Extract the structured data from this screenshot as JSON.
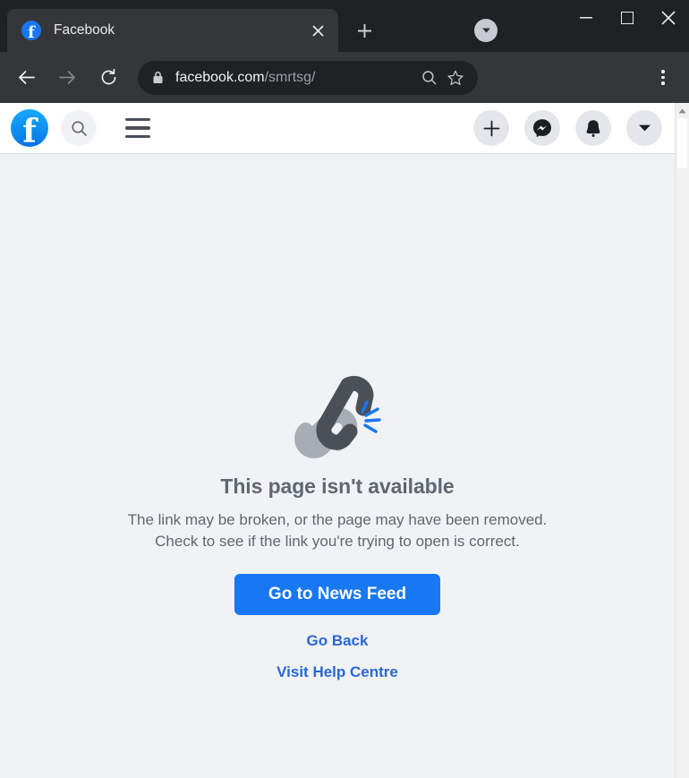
{
  "browser": {
    "tab": {
      "title": "Facebook",
      "favicon": "facebook-favicon",
      "close_label": "×"
    },
    "new_tab_label": "+",
    "tab_search_icon": "chevron-down-icon",
    "window_controls": {
      "minimize": "—",
      "maximize": "maximize-icon",
      "close": "✕"
    },
    "toolbar": {
      "back_icon": "back-arrow-icon",
      "forward_icon": "forward-arrow-icon",
      "reload_icon": "reload-icon",
      "lock_icon": "lock-icon",
      "url_domain": "facebook.com",
      "url_path": "/smrtsg/",
      "zoom_icon": "search-zoom-icon",
      "bookmark_icon": "star-icon",
      "menu_icon": "three-dot-menu-icon"
    }
  },
  "fb_header": {
    "logo": "facebook-logo",
    "logo_letter": "f",
    "search_icon": "search-icon",
    "menu_icon": "hamburger-menu-icon",
    "actions": [
      {
        "name": "create-button",
        "icon": "plus-icon"
      },
      {
        "name": "messenger-button",
        "icon": "messenger-icon"
      },
      {
        "name": "notifications-button",
        "icon": "bell-icon"
      },
      {
        "name": "account-button",
        "icon": "chevron-down-icon"
      }
    ]
  },
  "error_page": {
    "illustration": "broken-link-icon",
    "title": "This page isn't available",
    "body": "The link may be broken, or the page may have been removed. Check to see if the link you're trying to open is correct.",
    "primary_button": "Go to News Feed",
    "links": [
      "Go Back",
      "Visit Help Centre"
    ]
  },
  "colors": {
    "facebook_blue": "#1877f2",
    "page_background": "#f0f2f5",
    "text_gray": "#606770",
    "link_blue": "#2a67d4",
    "tabstrip_dark": "#202124",
    "toolbar_dark": "#35363a"
  }
}
